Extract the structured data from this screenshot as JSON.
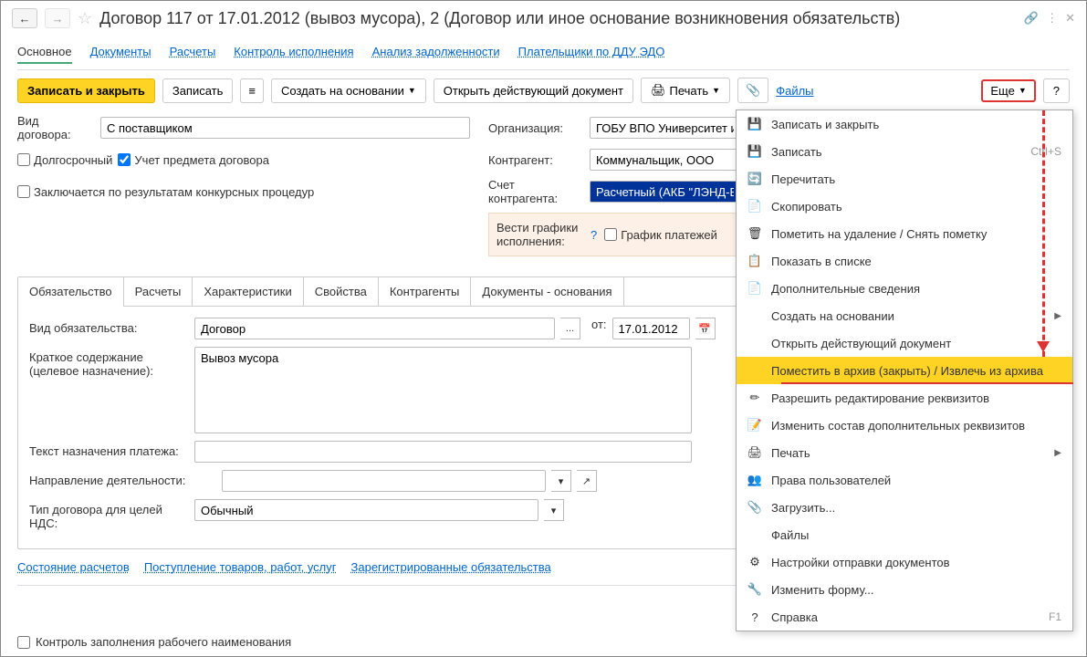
{
  "header": {
    "title": "Договор 117 от 17.01.2012 (вывоз мусора), 2 (Договор или иное основание возникновения обязательств)"
  },
  "nav": {
    "tabs": [
      "Основное",
      "Документы",
      "Расчеты",
      "Контроль исполнения",
      "Анализ задолженности",
      "Плательщики по ДДУ ЭДО"
    ]
  },
  "toolbar": {
    "save_close": "Записать и закрыть",
    "save": "Записать",
    "create_based": "Создать на основании",
    "open_doc": "Открыть действующий документ",
    "print": "Печать",
    "files": "Файлы",
    "more": "Еще",
    "help": "?"
  },
  "form": {
    "contract_type_label": "Вид договора:",
    "contract_type_value": "С поставщиком",
    "long_term": "Долгосрочный",
    "subject_accounting": "Учет предмета договора",
    "competitive": "Заключается по результатам конкурсных процедур",
    "org_label": "Организация:",
    "org_value": "ГОБУ ВПО Университет и",
    "counterparty_label": "Контрагент:",
    "counterparty_value": "Коммунальщик, ООО",
    "account_label": "Счет контрагента:",
    "account_value": "Расчетный (АКБ \"ЛЭНД-Б",
    "schedule_label": "Вести графики исполнения:",
    "payment_schedule": "График платежей"
  },
  "tabs": [
    "Обязательство",
    "Расчеты",
    "Характеристики",
    "Свойства",
    "Контрагенты",
    "Документы - основания"
  ],
  "obligation": {
    "type_label": "Вид обязательства:",
    "type_value": "Договор",
    "date_label": "от:",
    "date_value": "17.01.2012",
    "summary_label": "Краткое содержание (целевое назначение):",
    "summary_value": "Вывоз мусора",
    "payment_text_label": "Текст назначения платежа:",
    "direction_label": "Направление деятельности:",
    "vat_type_label": "Тип договора для целей НДС:",
    "vat_type_value": "Обычный"
  },
  "bottom_links": {
    "status": "Состояние расчетов",
    "receipt": "Поступление товаров, работ, услуг",
    "registered": "Зарегистрированные обязательства"
  },
  "footer": {
    "control": "Контроль заполнения рабочего наименования"
  },
  "menu": {
    "items": [
      {
        "icon": "💾",
        "text": "Записать и закрыть",
        "shortcut": ""
      },
      {
        "icon": "💾",
        "text": "Записать",
        "shortcut": "Ctrl+S"
      },
      {
        "icon": "🔄",
        "text": "Перечитать",
        "shortcut": ""
      },
      {
        "icon": "📄",
        "text": "Скопировать",
        "shortcut": ""
      },
      {
        "icon": "🗑",
        "text": "Пометить на удаление / Снять пометку",
        "shortcut": ""
      },
      {
        "icon": "📋",
        "text": "Показать в списке",
        "shortcut": ""
      },
      {
        "icon": "📄",
        "text": "Дополнительные сведения",
        "shortcut": ""
      },
      {
        "icon": "",
        "text": "Создать на основании",
        "shortcut": "",
        "sub": true
      },
      {
        "icon": "",
        "text": "Открыть действующий документ",
        "shortcut": ""
      },
      {
        "icon": "",
        "text": "Поместить в архив (закрыть) / Извлечь из архива",
        "shortcut": "",
        "hl": true
      },
      {
        "icon": "✏",
        "text": "Разрешить редактирование реквизитов",
        "shortcut": ""
      },
      {
        "icon": "📝",
        "text": "Изменить состав дополнительных реквизитов",
        "shortcut": ""
      },
      {
        "icon": "🖨",
        "text": "Печать",
        "shortcut": "",
        "sub": true
      },
      {
        "icon": "👥",
        "text": "Права пользователей",
        "shortcut": ""
      },
      {
        "icon": "📎",
        "text": "Загрузить...",
        "shortcut": ""
      },
      {
        "icon": "",
        "text": "Файлы",
        "shortcut": ""
      },
      {
        "icon": "⚙",
        "text": "Настройки отправки документов",
        "shortcut": ""
      },
      {
        "icon": "🔧",
        "text": "Изменить форму...",
        "shortcut": ""
      },
      {
        "icon": "?",
        "text": "Справка",
        "shortcut": "F1"
      }
    ]
  }
}
